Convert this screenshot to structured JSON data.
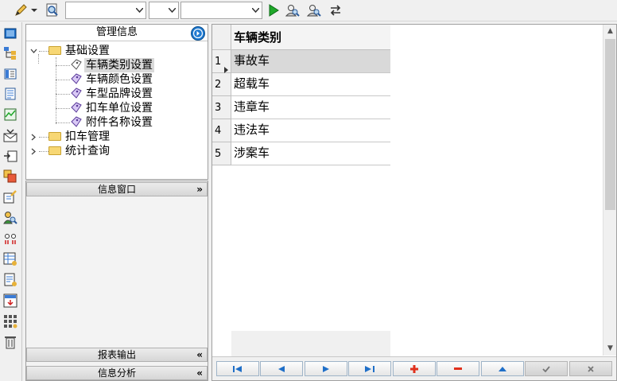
{
  "toolbar": {
    "combo1_value": "",
    "combo2_value": "",
    "combo3_value": ""
  },
  "tree": {
    "header": "管理信息",
    "nodes": [
      {
        "label": "基础设置",
        "level": 0,
        "expanded": true
      },
      {
        "label": "车辆类别设置",
        "level": 1,
        "selected": true
      },
      {
        "label": "车辆颜色设置",
        "level": 1
      },
      {
        "label": "车型品牌设置",
        "level": 1
      },
      {
        "label": "扣车单位设置",
        "level": 1
      },
      {
        "label": "附件名称设置",
        "level": 1
      },
      {
        "label": "扣车管理",
        "level": 0,
        "expanded": false
      },
      {
        "label": "统计查询",
        "level": 0,
        "expanded": false
      }
    ]
  },
  "panels": {
    "info_window": "信息窗口",
    "report_output": "报表输出",
    "info_analysis": "信息分析"
  },
  "grid": {
    "column_header": "车辆类别",
    "rows": [
      {
        "num": "1",
        "value": "事故车"
      },
      {
        "num": "2",
        "value": "超载车"
      },
      {
        "num": "3",
        "value": "违章车"
      },
      {
        "num": "4",
        "value": "违法车"
      },
      {
        "num": "5",
        "value": "涉案车"
      }
    ],
    "current_row": 1
  },
  "colors": {
    "nav_arrow": "#1f6fc8",
    "add": "#e0301c",
    "remove": "#e0301c",
    "selection": "#d9d9d9"
  }
}
